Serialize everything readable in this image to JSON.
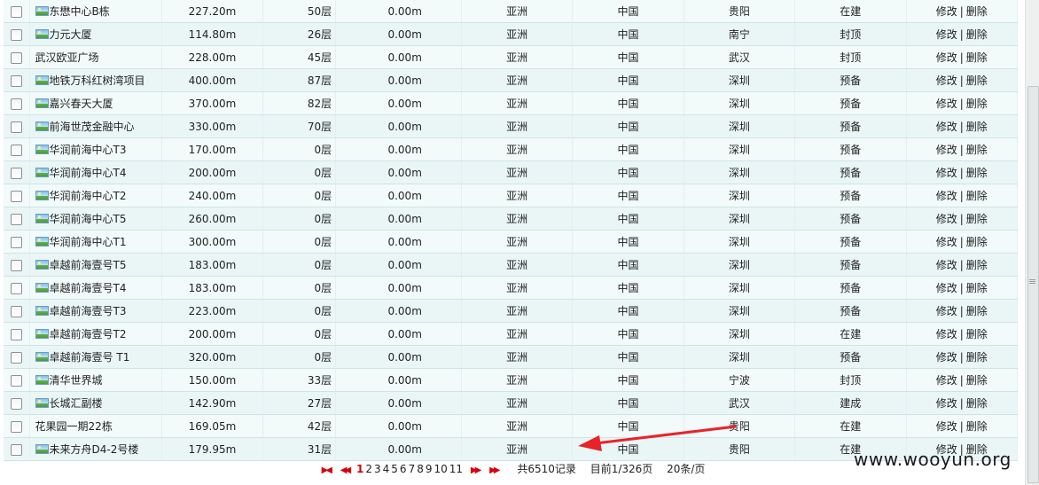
{
  "rows": [
    {
      "name": "东懋中心B栋",
      "icon": true,
      "height": "227.20m",
      "floors": "50层",
      "area": "0.00m",
      "continent": "亚洲",
      "country": "中国",
      "city": "贵阳",
      "status": "在建"
    },
    {
      "name": "力元大厦",
      "icon": true,
      "height": "114.80m",
      "floors": "26层",
      "area": "0.00m",
      "continent": "亚洲",
      "country": "中国",
      "city": "南宁",
      "status": "封顶"
    },
    {
      "name": "武汉欧亚广场",
      "icon": false,
      "height": "228.00m",
      "floors": "45层",
      "area": "0.00m",
      "continent": "亚洲",
      "country": "中国",
      "city": "武汉",
      "status": "封顶"
    },
    {
      "name": "地铁万科红树湾项目",
      "icon": true,
      "height": "400.00m",
      "floors": "87层",
      "area": "0.00m",
      "continent": "亚洲",
      "country": "中国",
      "city": "深圳",
      "status": "预备"
    },
    {
      "name": "嘉兴春天大厦",
      "icon": true,
      "height": "370.00m",
      "floors": "82层",
      "area": "0.00m",
      "continent": "亚洲",
      "country": "中国",
      "city": "深圳",
      "status": "预备"
    },
    {
      "name": "前海世茂金融中心",
      "icon": true,
      "height": "330.00m",
      "floors": "70层",
      "area": "0.00m",
      "continent": "亚洲",
      "country": "中国",
      "city": "深圳",
      "status": "预备"
    },
    {
      "name": "华润前海中心T3",
      "icon": true,
      "height": "170.00m",
      "floors": "0层",
      "area": "0.00m",
      "continent": "亚洲",
      "country": "中国",
      "city": "深圳",
      "status": "预备"
    },
    {
      "name": "华润前海中心T4",
      "icon": true,
      "height": "200.00m",
      "floors": "0层",
      "area": "0.00m",
      "continent": "亚洲",
      "country": "中国",
      "city": "深圳",
      "status": "预备"
    },
    {
      "name": "华润前海中心T2",
      "icon": true,
      "height": "240.00m",
      "floors": "0层",
      "area": "0.00m",
      "continent": "亚洲",
      "country": "中国",
      "city": "深圳",
      "status": "预备"
    },
    {
      "name": "华润前海中心T5",
      "icon": true,
      "height": "260.00m",
      "floors": "0层",
      "area": "0.00m",
      "continent": "亚洲",
      "country": "中国",
      "city": "深圳",
      "status": "预备"
    },
    {
      "name": "华润前海中心T1",
      "icon": true,
      "height": "300.00m",
      "floors": "0层",
      "area": "0.00m",
      "continent": "亚洲",
      "country": "中国",
      "city": "深圳",
      "status": "预备"
    },
    {
      "name": "卓越前海壹号T5",
      "icon": true,
      "height": "183.00m",
      "floors": "0层",
      "area": "0.00m",
      "continent": "亚洲",
      "country": "中国",
      "city": "深圳",
      "status": "预备"
    },
    {
      "name": "卓越前海壹号T4",
      "icon": true,
      "height": "183.00m",
      "floors": "0层",
      "area": "0.00m",
      "continent": "亚洲",
      "country": "中国",
      "city": "深圳",
      "status": "预备"
    },
    {
      "name": "卓越前海壹号T3",
      "icon": true,
      "height": "223.00m",
      "floors": "0层",
      "area": "0.00m",
      "continent": "亚洲",
      "country": "中国",
      "city": "深圳",
      "status": "预备"
    },
    {
      "name": "卓越前海壹号T2",
      "icon": true,
      "height": "200.00m",
      "floors": "0层",
      "area": "0.00m",
      "continent": "亚洲",
      "country": "中国",
      "city": "深圳",
      "status": "在建"
    },
    {
      "name": "卓越前海壹号 T1",
      "icon": true,
      "height": "320.00m",
      "floors": "0层",
      "area": "0.00m",
      "continent": "亚洲",
      "country": "中国",
      "city": "深圳",
      "status": "预备"
    },
    {
      "name": "清华世界城",
      "icon": true,
      "height": "150.00m",
      "floors": "33层",
      "area": "0.00m",
      "continent": "亚洲",
      "country": "中国",
      "city": "宁波",
      "status": "封顶"
    },
    {
      "name": "长城汇副楼",
      "icon": true,
      "height": "142.90m",
      "floors": "27层",
      "area": "0.00m",
      "continent": "亚洲",
      "country": "中国",
      "city": "武汉",
      "status": "建成"
    },
    {
      "name": "花果园一期22栋",
      "icon": false,
      "height": "169.05m",
      "floors": "42层",
      "area": "0.00m",
      "continent": "亚洲",
      "country": "中国",
      "city": "贵阳",
      "status": "在建"
    },
    {
      "name": "未来方舟D4-2号楼",
      "icon": true,
      "height": "179.95m",
      "floors": "31层",
      "area": "0.00m",
      "continent": "亚洲",
      "country": "中国",
      "city": "贵阳",
      "status": "在建"
    }
  ],
  "row_actions": {
    "edit": "修改",
    "separator": "|",
    "delete": "删除"
  },
  "pager": {
    "pages": [
      "1",
      "2",
      "3",
      "4",
      "5",
      "6",
      "7",
      "8",
      "9",
      "10",
      "11"
    ],
    "current_page": "1",
    "total_records": "共6510记录",
    "current": "目前1/326页",
    "per_page": "20条/页"
  },
  "watermark": "www.wooyun.org",
  "colors": {
    "row_bg": "#eaf6f6",
    "pager_nav": "#d6000f",
    "annotation_arrow": "#e8232a"
  }
}
